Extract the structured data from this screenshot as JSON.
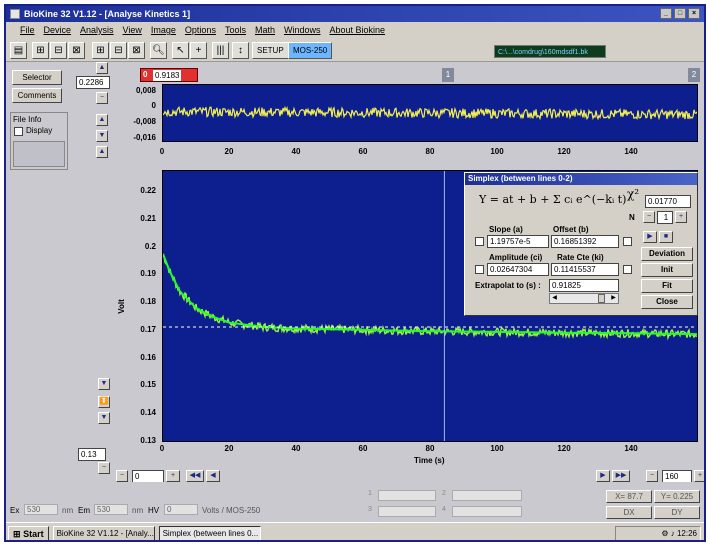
{
  "window": {
    "title": "BioKine 32 V1.12 - [Analyse Kinetics 1]"
  },
  "menu": [
    "File",
    "Device",
    "Analysis",
    "View",
    "Image",
    "Options",
    "Tools",
    "Math",
    "Windows",
    "About Biokine"
  ],
  "toolbar": {
    "setup": "SETUP",
    "mos": "MOS-250",
    "file_path": "C:\\...\\comdrug\\160mdsdf1.bk"
  },
  "left_panel": {
    "selector": "Selector",
    "comments": "Comments",
    "file_info": "File Info",
    "display": "Display",
    "top_value": "0.2286",
    "bottom_value": "0.13"
  },
  "markers": {
    "marker0_label": "0",
    "marker0_value": "0.9183",
    "marker1": "1",
    "marker2": "2"
  },
  "top_plot": {
    "y_ticks": [
      "0,008",
      "0",
      "-0,008",
      "-0,016"
    ],
    "x_ticks": [
      "0",
      "20",
      "40",
      "60",
      "80",
      "100",
      "120",
      "140"
    ]
  },
  "main_plot": {
    "y_label": "Volt",
    "x_label": "Time (s)",
    "y_ticks": [
      "0.22",
      "0.21",
      "0.2",
      "0.19",
      "0.18",
      "0.17",
      "0.16",
      "0.15",
      "0.14",
      "0.13"
    ],
    "x_ticks": [
      "0",
      "20",
      "40",
      "60",
      "80",
      "100",
      "120",
      "140"
    ]
  },
  "chart_data": {
    "type": "line",
    "title": "",
    "xlabel": "Time (s)",
    "ylabel": "Volt",
    "xlim": [
      0,
      160
    ],
    "ylim": [
      0.13,
      0.225
    ],
    "series": [
      {
        "x": [
          0,
          2,
          5,
          10,
          15,
          20,
          30,
          40,
          60,
          80,
          100,
          120,
          140,
          160
        ],
        "values": [
          0.196,
          0.19,
          0.183,
          0.177,
          0.174,
          0.172,
          0.1705,
          0.17,
          0.1695,
          0.169,
          0.1688,
          0.1685,
          0.1683,
          0.168
        ]
      }
    ]
  },
  "simplex": {
    "title": "Simplex (between lines 0-2)",
    "formula": "Y = at + b + Σ cᵢ e^(−kᵢ t)",
    "chi_symbol": "χ²",
    "chi_value": "0.01770",
    "n_label": "N",
    "n_value": "1",
    "slope_label": "Slope (a)",
    "slope_value": "1.19757e-5",
    "offset_label": "Offset (b)",
    "offset_value": "0.16851392",
    "amplitude_label": "Amplitude (ci)",
    "amplitude_value": "0.02647304",
    "rate_label": "Rate Cte (ki)",
    "rate_value": "0.11415537",
    "extrapolate_label": "Extrapolat to (s) :",
    "extrapolate_value": "0.91825",
    "btn_deviation": "Deviation",
    "btn_init": "Init",
    "btn_fit": "Fit",
    "btn_close": "Close"
  },
  "bottom": {
    "left_value": "0",
    "right_value": "160"
  },
  "status": {
    "ex_label": "Ex",
    "ex_value": "530",
    "ex_unit": "nm",
    "em_label": "Em",
    "em_value": "530",
    "em_unit": "nm",
    "hv_label": "HV",
    "hv_value": "0",
    "hv_unit": "Volts / MOS-250",
    "ch": [
      "1",
      "2",
      "3",
      "4"
    ],
    "x_coord": "X= 87.7",
    "y_coord": "Y= 0.225",
    "dx": "DX",
    "dy": "DY"
  },
  "taskbar": {
    "start": "Start",
    "item1": "BioKine 32 V1.12 - [Analy...",
    "item2": "Simplex (between lines 0...",
    "clock": "12:26"
  },
  "colors": {
    "plot_bg": "#0d1e8e",
    "top_signal": "#f2ee52",
    "main_signal": "#9ef24a",
    "fit": "#22ff22"
  }
}
